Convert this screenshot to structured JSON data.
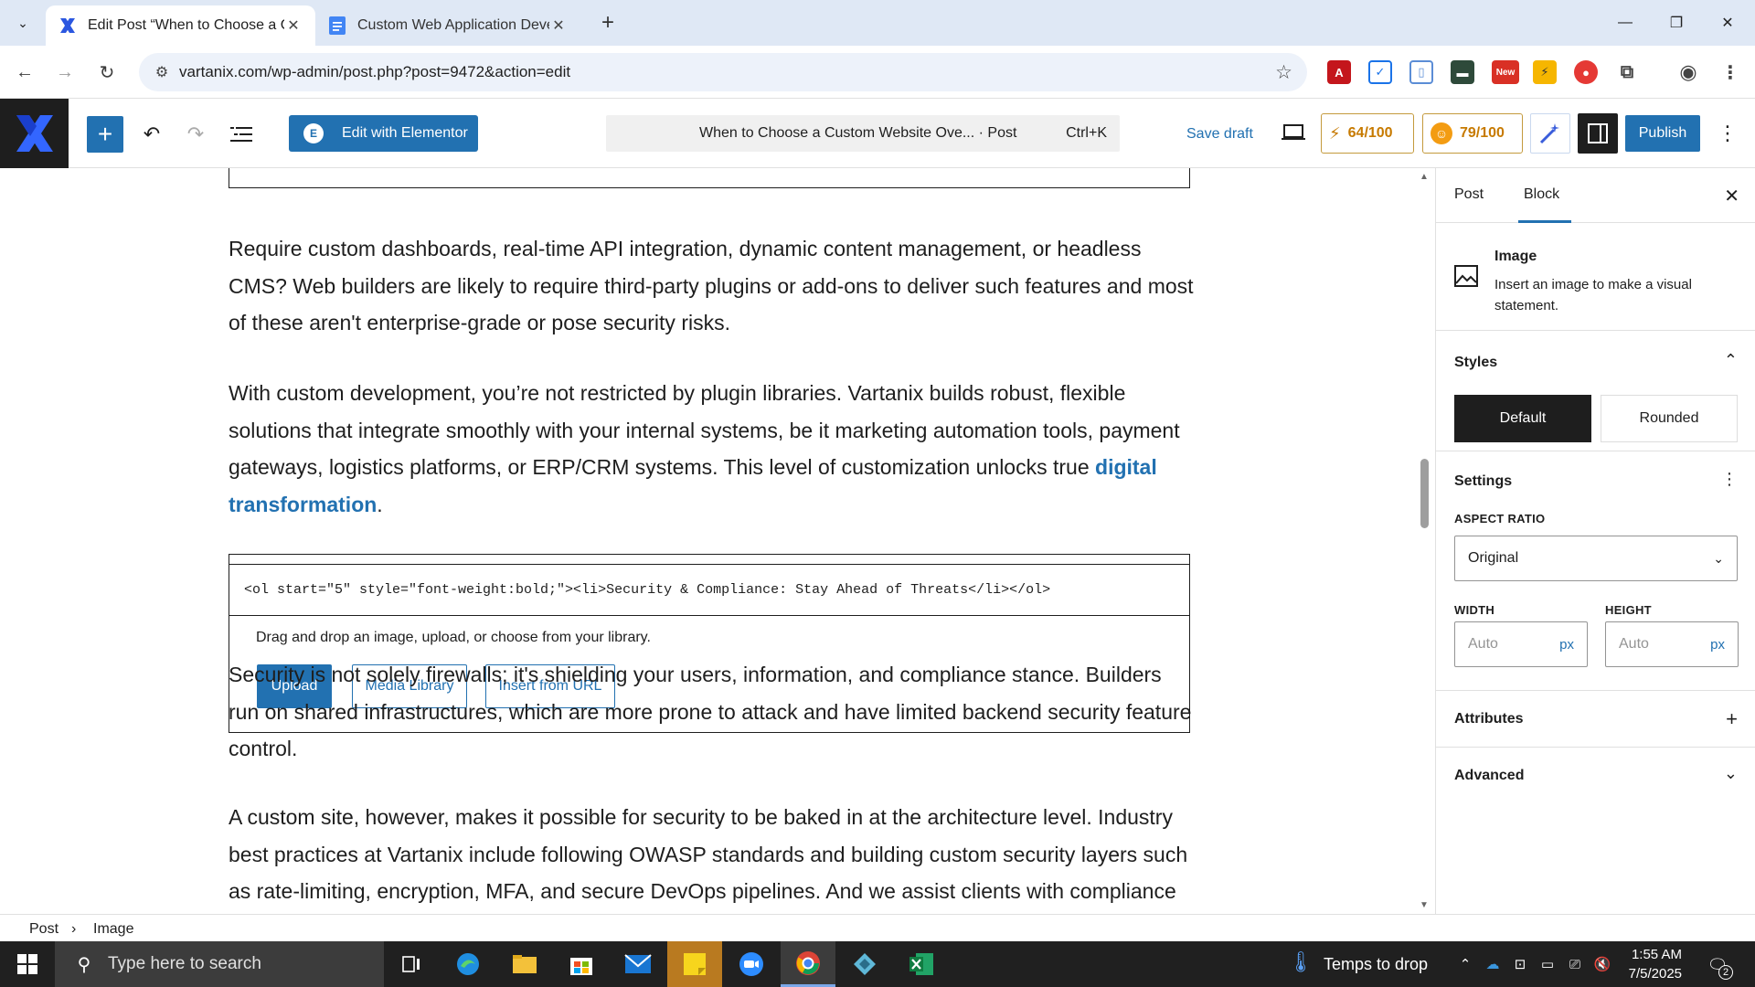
{
  "browser": {
    "tabs": [
      {
        "title": "Edit Post “When to Choose a Cu",
        "active": true,
        "icon": "vartanix-x-icon"
      },
      {
        "title": "Custom Web Application Devel",
        "active": false,
        "icon": "google-docs-icon"
      }
    ],
    "new_tab": "+",
    "url": "vartanix.com/wp-admin/post.php?post=9472&action=edit",
    "extensions": [
      "acrobat-icon",
      "shield-extension-icon",
      "doc-extension-icon",
      "folder-extension-icon",
      "new-badge-extension-icon",
      "lightning-extension-icon",
      "pokeball-extension-icon",
      "puzzle-extensions-icon"
    ],
    "new_badge": "New"
  },
  "wp_header": {
    "edit_elementor": "Edit with Elementor",
    "elementor_icon": "E",
    "command_title": "When to Choose a Custom Website Ove... · Post",
    "command_shortcut": "Ctrl+K",
    "save_draft": "Save draft",
    "seo_score": "64/100",
    "readability_score": "79/100",
    "publish": "Publish",
    "colors": {
      "accent": "#2271b1",
      "score": "#c77a00"
    }
  },
  "content": {
    "para1": "Require custom dashboards, real-time API integration, dynamic content management, or headless CMS? Web builders are likely to require third-party plugins or add-ons to deliver such features and most of these aren't enterprise-grade or pose security risks.",
    "para2_text": "With custom development, you’re not restricted by plugin libraries. Vartanix builds robust, flexible solutions that integrate smoothly with your internal systems, be it marketing automation tools, payment gateways, logistics platforms, or ERP/CRM systems. This level of customization unlocks true ",
    "para2_link": "digital transformation",
    "para2_end": ".",
    "html_code": "<ol start=\"5\" style=\"font-weight:bold;\"><li>Security & Compliance: Stay Ahead of Threats</li></ol>",
    "image_hint": "Drag and drop an image, upload, or choose from your library.",
    "upload": "Upload",
    "media_library": "Media Library",
    "insert_url": "Insert from URL",
    "para3": "Security is not solely firewalls; it's shielding your users, information, and compliance stance. Builders run on shared infrastructures, which are more prone to attack and have limited backend security feature control.",
    "para4": "A custom site, however, makes it possible for security to be baked in at the architecture level. Industry best practices at Vartanix include following OWASP standards and building custom security layers such as rate-limiting, encryption, MFA, and secure DevOps pipelines. And we assist clients with compliance in"
  },
  "sidebar": {
    "tab_post": "Post",
    "tab_block": "Block",
    "block_name": "Image",
    "block_desc": "Insert an image to make a visual statement.",
    "styles_title": "Styles",
    "style_default": "Default",
    "style_rounded": "Rounded",
    "settings_title": "Settings",
    "aspect_label": "ASPECT RATIO",
    "aspect_value": "Original",
    "width_label": "WIDTH",
    "height_label": "HEIGHT",
    "width_placeholder": "Auto",
    "height_placeholder": "Auto",
    "unit": "px",
    "attributes_title": "Attributes",
    "advanced_title": "Advanced"
  },
  "breadcrumb": {
    "root": "Post",
    "sep": "›",
    "current": "Image"
  },
  "taskbar": {
    "search_placeholder": "Type here to search",
    "weather": "Temps to drop",
    "time": "1:55 AM",
    "date": "7/5/2025",
    "notification_count": "2"
  }
}
